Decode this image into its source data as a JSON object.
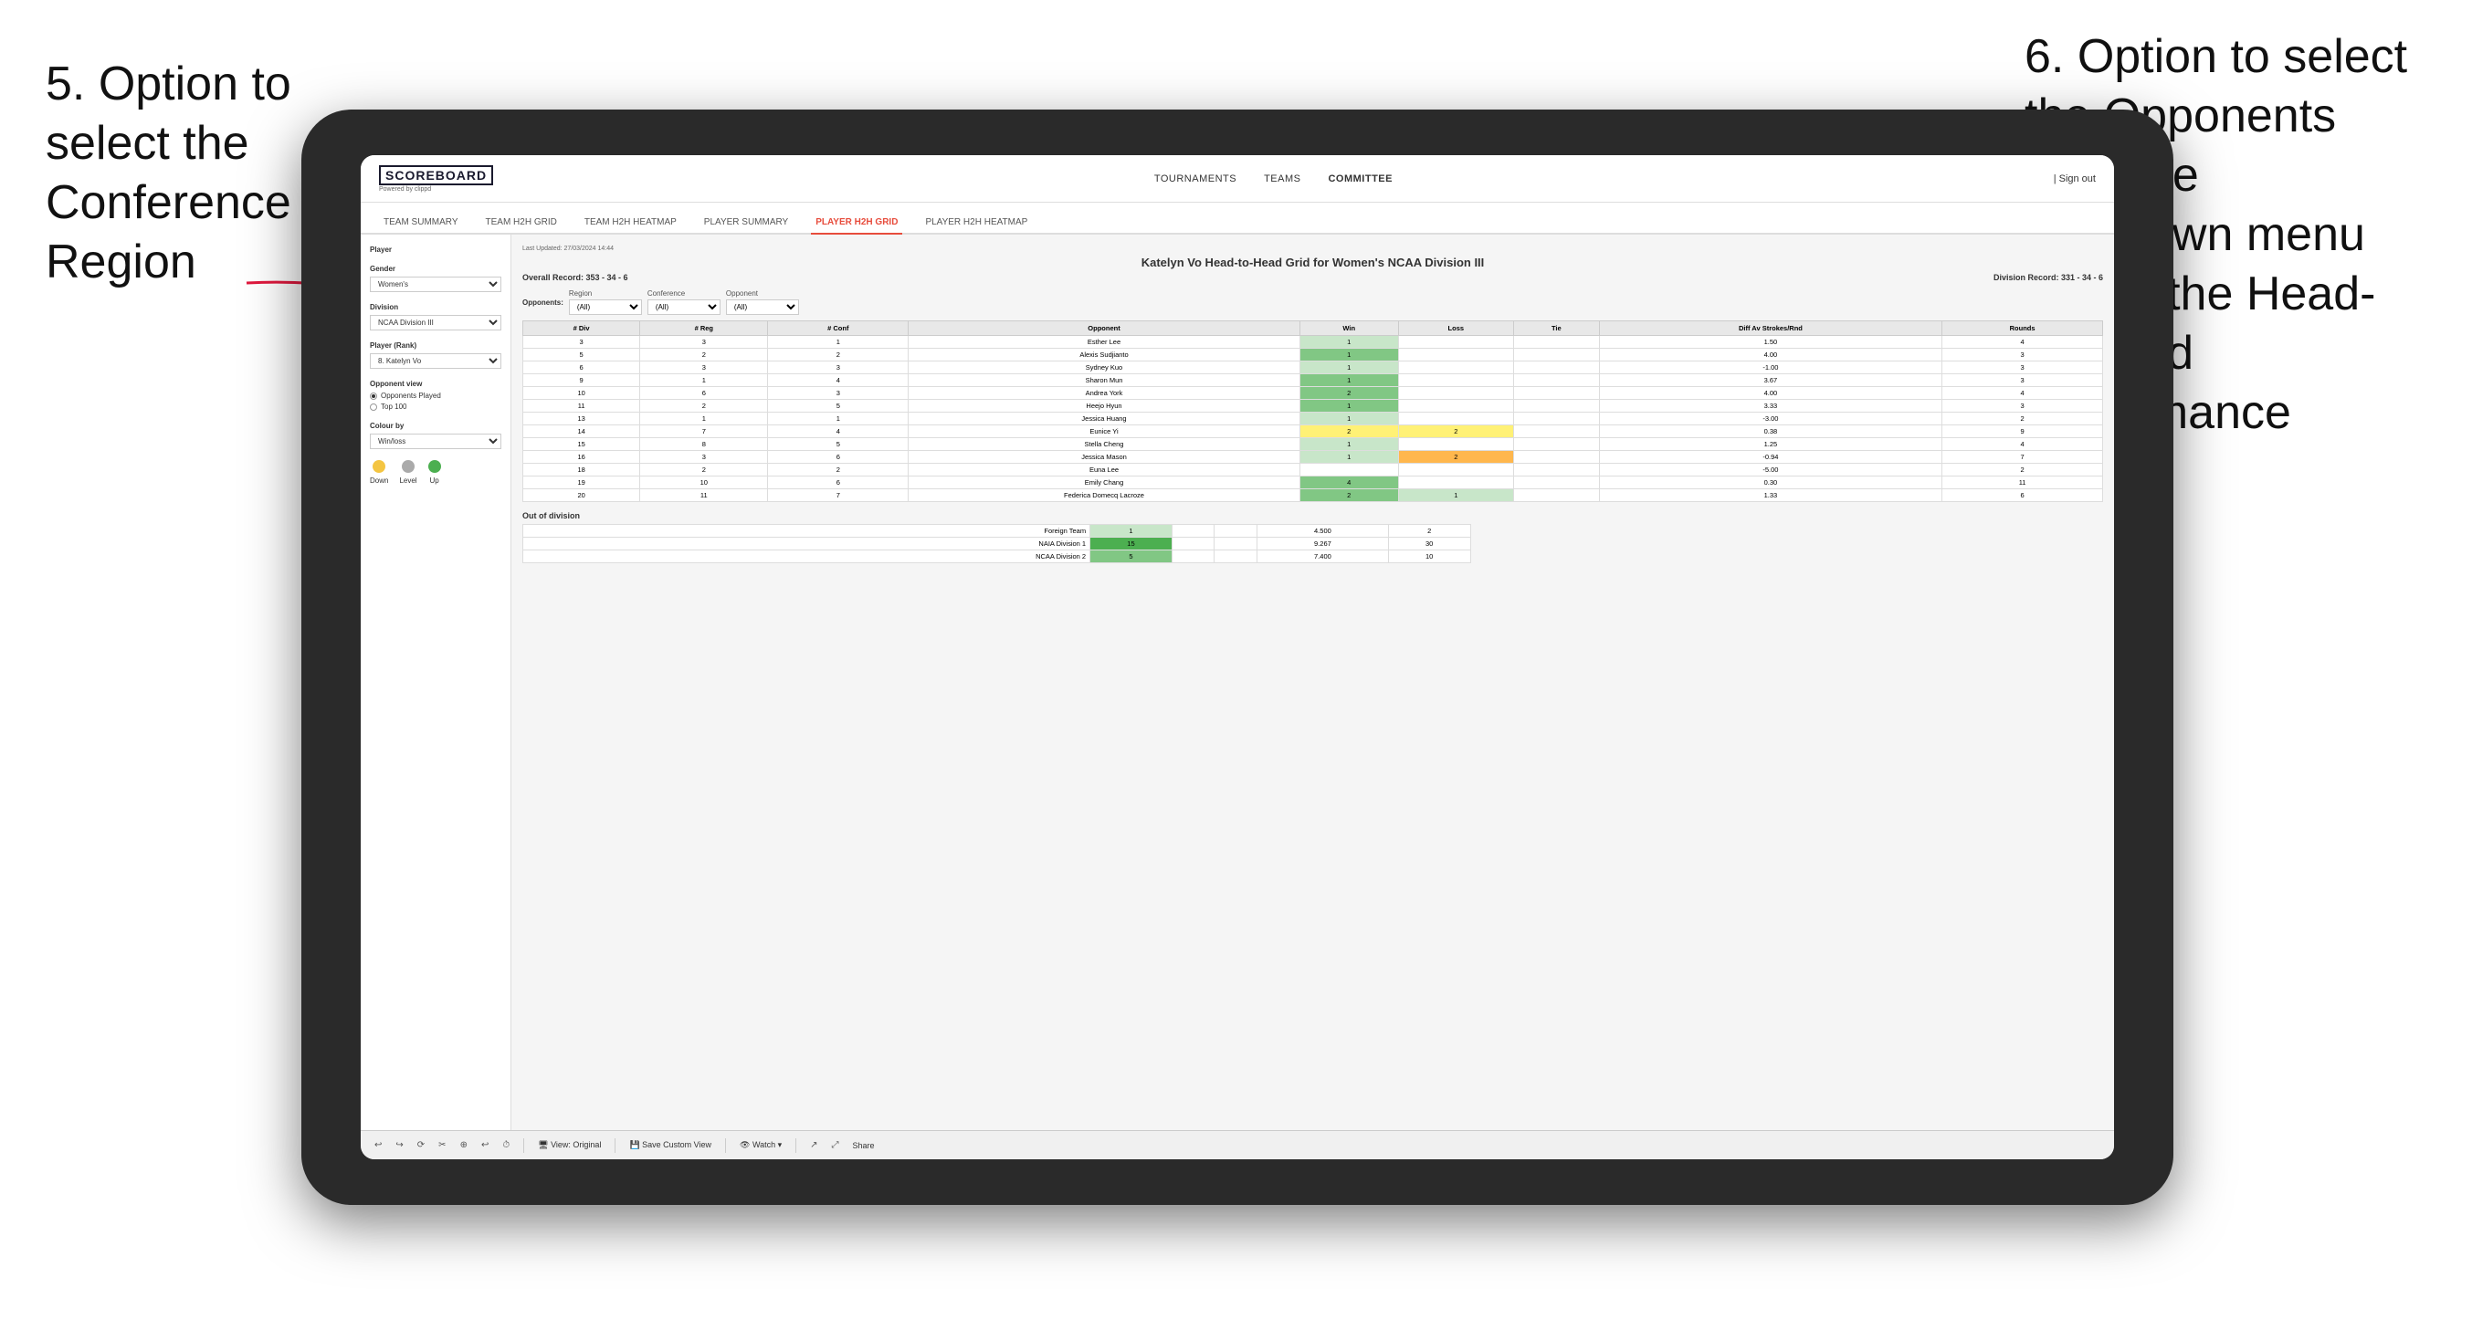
{
  "annotations": {
    "left": {
      "line1": "5. Option to",
      "line2": "select the",
      "line3": "Conference and",
      "line4": "Region"
    },
    "right": {
      "line1": "6. Option to select",
      "line2": "the Opponents",
      "line3": "from the",
      "line4": "dropdown menu",
      "line5": "to see the Head-",
      "line6": "to-Head",
      "line7": "performance"
    }
  },
  "nav": {
    "logo": "SCOREBOARD",
    "logo_sub": "Powered by clippd",
    "links": [
      "TOURNAMENTS",
      "TEAMS",
      "COMMITTEE"
    ],
    "sign_out": "Sign out"
  },
  "sub_nav": {
    "items": [
      "TEAM SUMMARY",
      "TEAM H2H GRID",
      "TEAM H2H HEATMAP",
      "PLAYER SUMMARY",
      "PLAYER H2H GRID",
      "PLAYER H2H HEATMAP"
    ]
  },
  "left_panel": {
    "player_label": "Player",
    "gender_label": "Gender",
    "gender_value": "Women's",
    "division_label": "Division",
    "division_value": "NCAA Division III",
    "player_rank_label": "Player (Rank)",
    "player_rank_value": "8. Katelyn Vo",
    "opponent_view_label": "Opponent view",
    "opponent_options": [
      "Opponents Played",
      "Top 100"
    ],
    "colour_by_label": "Colour by",
    "colour_by_value": "Win/loss",
    "colour_labels": [
      "Down",
      "Level",
      "Up"
    ]
  },
  "content": {
    "last_updated": "Last Updated: 27/03/2024 14:44",
    "title": "Katelyn Vo Head-to-Head Grid for Women's NCAA Division III",
    "overall_record": "Overall Record: 353 - 34 - 6",
    "division_record": "Division Record: 331 - 34 - 6",
    "filters": {
      "region_label": "Region",
      "opponents_label": "Opponents:",
      "region_value": "(All)",
      "conference_label": "Conference",
      "conference_value": "(All)",
      "opponent_label": "Opponent",
      "opponent_value": "(All)"
    },
    "table_headers": [
      "# Div",
      "# Reg",
      "# Conf",
      "Opponent",
      "Win",
      "Loss",
      "Tie",
      "Diff Av Strokes/Rnd",
      "Rounds"
    ],
    "rows": [
      {
        "div": "3",
        "reg": "3",
        "conf": "1",
        "opponent": "Esther Lee",
        "win": "1",
        "loss": "",
        "tie": "",
        "diff": "1.50",
        "rounds": "4",
        "win_color": "green_light",
        "loss_color": "white",
        "tie_color": "white"
      },
      {
        "div": "5",
        "reg": "2",
        "conf": "2",
        "opponent": "Alexis Sudjianto",
        "win": "1",
        "loss": "",
        "tie": "",
        "diff": "4.00",
        "rounds": "3",
        "win_color": "green_mid",
        "loss_color": "white",
        "tie_color": "white"
      },
      {
        "div": "6",
        "reg": "3",
        "conf": "3",
        "opponent": "Sydney Kuo",
        "win": "1",
        "loss": "",
        "tie": "",
        "diff": "-1.00",
        "rounds": "3",
        "win_color": "green_light",
        "loss_color": "white",
        "tie_color": "white"
      },
      {
        "div": "9",
        "reg": "1",
        "conf": "4",
        "opponent": "Sharon Mun",
        "win": "1",
        "loss": "",
        "tie": "",
        "diff": "3.67",
        "rounds": "3",
        "win_color": "green_mid",
        "loss_color": "white",
        "tie_color": "white"
      },
      {
        "div": "10",
        "reg": "6",
        "conf": "3",
        "opponent": "Andrea York",
        "win": "2",
        "loss": "",
        "tie": "",
        "diff": "4.00",
        "rounds": "4",
        "win_color": "green_mid",
        "loss_color": "white",
        "tie_color": "white"
      },
      {
        "div": "11",
        "reg": "2",
        "conf": "5",
        "opponent": "Heejo Hyun",
        "win": "1",
        "loss": "",
        "tie": "",
        "diff": "3.33",
        "rounds": "3",
        "win_color": "green_mid",
        "loss_color": "white",
        "tie_color": "white"
      },
      {
        "div": "13",
        "reg": "1",
        "conf": "1",
        "opponent": "Jessica Huang",
        "win": "1",
        "loss": "",
        "tie": "",
        "diff": "-3.00",
        "rounds": "2",
        "win_color": "green_light",
        "loss_color": "white",
        "tie_color": "white"
      },
      {
        "div": "14",
        "reg": "7",
        "conf": "4",
        "opponent": "Eunice Yi",
        "win": "2",
        "loss": "2",
        "tie": "",
        "diff": "0.38",
        "rounds": "9",
        "win_color": "yellow",
        "loss_color": "yellow",
        "tie_color": "white"
      },
      {
        "div": "15",
        "reg": "8",
        "conf": "5",
        "opponent": "Stella Cheng",
        "win": "1",
        "loss": "",
        "tie": "",
        "diff": "1.25",
        "rounds": "4",
        "win_color": "green_light",
        "loss_color": "white",
        "tie_color": "white"
      },
      {
        "div": "16",
        "reg": "3",
        "conf": "6",
        "opponent": "Jessica Mason",
        "win": "1",
        "loss": "2",
        "tie": "",
        "diff": "-0.94",
        "rounds": "7",
        "win_color": "green_light",
        "loss_color": "orange",
        "tie_color": "white"
      },
      {
        "div": "18",
        "reg": "2",
        "conf": "2",
        "opponent": "Euna Lee",
        "win": "",
        "loss": "",
        "tie": "",
        "diff": "-5.00",
        "rounds": "2",
        "win_color": "white",
        "loss_color": "white",
        "tie_color": "white"
      },
      {
        "div": "19",
        "reg": "10",
        "conf": "6",
        "opponent": "Emily Chang",
        "win": "4",
        "loss": "",
        "tie": "",
        "diff": "0.30",
        "rounds": "11",
        "win_color": "green_mid",
        "loss_color": "white",
        "tie_color": "white"
      },
      {
        "div": "20",
        "reg": "11",
        "conf": "7",
        "opponent": "Federica Domecq Lacroze",
        "win": "2",
        "loss": "1",
        "tie": "",
        "diff": "1.33",
        "rounds": "6",
        "win_color": "green_mid",
        "loss_color": "green_light",
        "tie_color": "white"
      }
    ],
    "out_of_division_label": "Out of division",
    "out_of_division_rows": [
      {
        "label": "Foreign Team",
        "win": "1",
        "loss": "",
        "tie": "",
        "diff": "4.500",
        "rounds": "2",
        "win_color": "green_light"
      },
      {
        "label": "NAIA Division 1",
        "win": "15",
        "loss": "",
        "tie": "",
        "diff": "9.267",
        "rounds": "30",
        "win_color": "green_dark"
      },
      {
        "label": "NCAA Division 2",
        "win": "5",
        "loss": "",
        "tie": "",
        "diff": "7.400",
        "rounds": "10",
        "win_color": "green_mid"
      }
    ]
  },
  "toolbar": {
    "items": [
      "↩",
      "↪",
      "⟳",
      "✂",
      "⊕",
      "↩",
      "⏱",
      "|",
      "View: Original",
      "|",
      "Save Custom View",
      "|",
      "Watch ▾",
      "|",
      "↗",
      "⤢",
      "Share"
    ]
  }
}
